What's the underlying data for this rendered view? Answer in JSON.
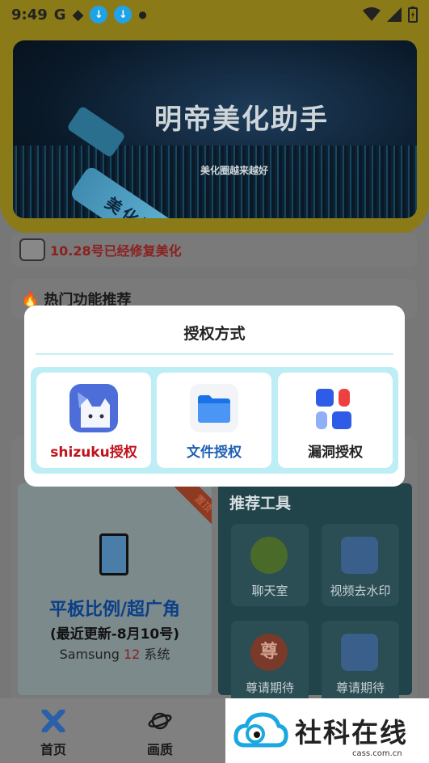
{
  "status_bar": {
    "time": "9:49"
  },
  "banner": {
    "title": "明帝美化助手",
    "subtitle": "美化圈越来越好",
    "stick_text": "美化圈永不倒"
  },
  "notice": {
    "text": "10.28号已经修复美化"
  },
  "hot_section": {
    "title": "热门功能推荐"
  },
  "dialog": {
    "title": "授权方式",
    "options": [
      {
        "label": "shizuku授权",
        "color": "#c0121a",
        "icon": "shizuku-cat-icon"
      },
      {
        "label": "文件授权",
        "color": "#1e5fb3",
        "icon": "folder-icon"
      },
      {
        "label": "漏洞授权",
        "color": "#222222",
        "icon": "apps-grid-icon"
      }
    ]
  },
  "featured_card": {
    "ribbon": "置顶",
    "title": "平板比例/超广角",
    "subtitle": "(最近更新-8月10号)",
    "device_prefix": "Samsung ",
    "device_num": "12",
    "device_suffix": " 系统"
  },
  "tools": {
    "header": "推荐工具",
    "items": [
      {
        "label": "聊天室",
        "icon": "sunglasses-face-icon"
      },
      {
        "label": "视频去水印",
        "icon": "video-camera-icon"
      },
      {
        "label": "尊请期待",
        "icon": "respect-badge-icon"
      },
      {
        "label": "尊请期待",
        "icon": "video-camera-icon"
      }
    ]
  },
  "bottom_nav": [
    {
      "label": "首页",
      "icon": "home-icon"
    },
    {
      "label": "画质",
      "icon": "planet-icon"
    }
  ],
  "watermark": {
    "text": "社科在线",
    "url": "cass.com.cn"
  }
}
